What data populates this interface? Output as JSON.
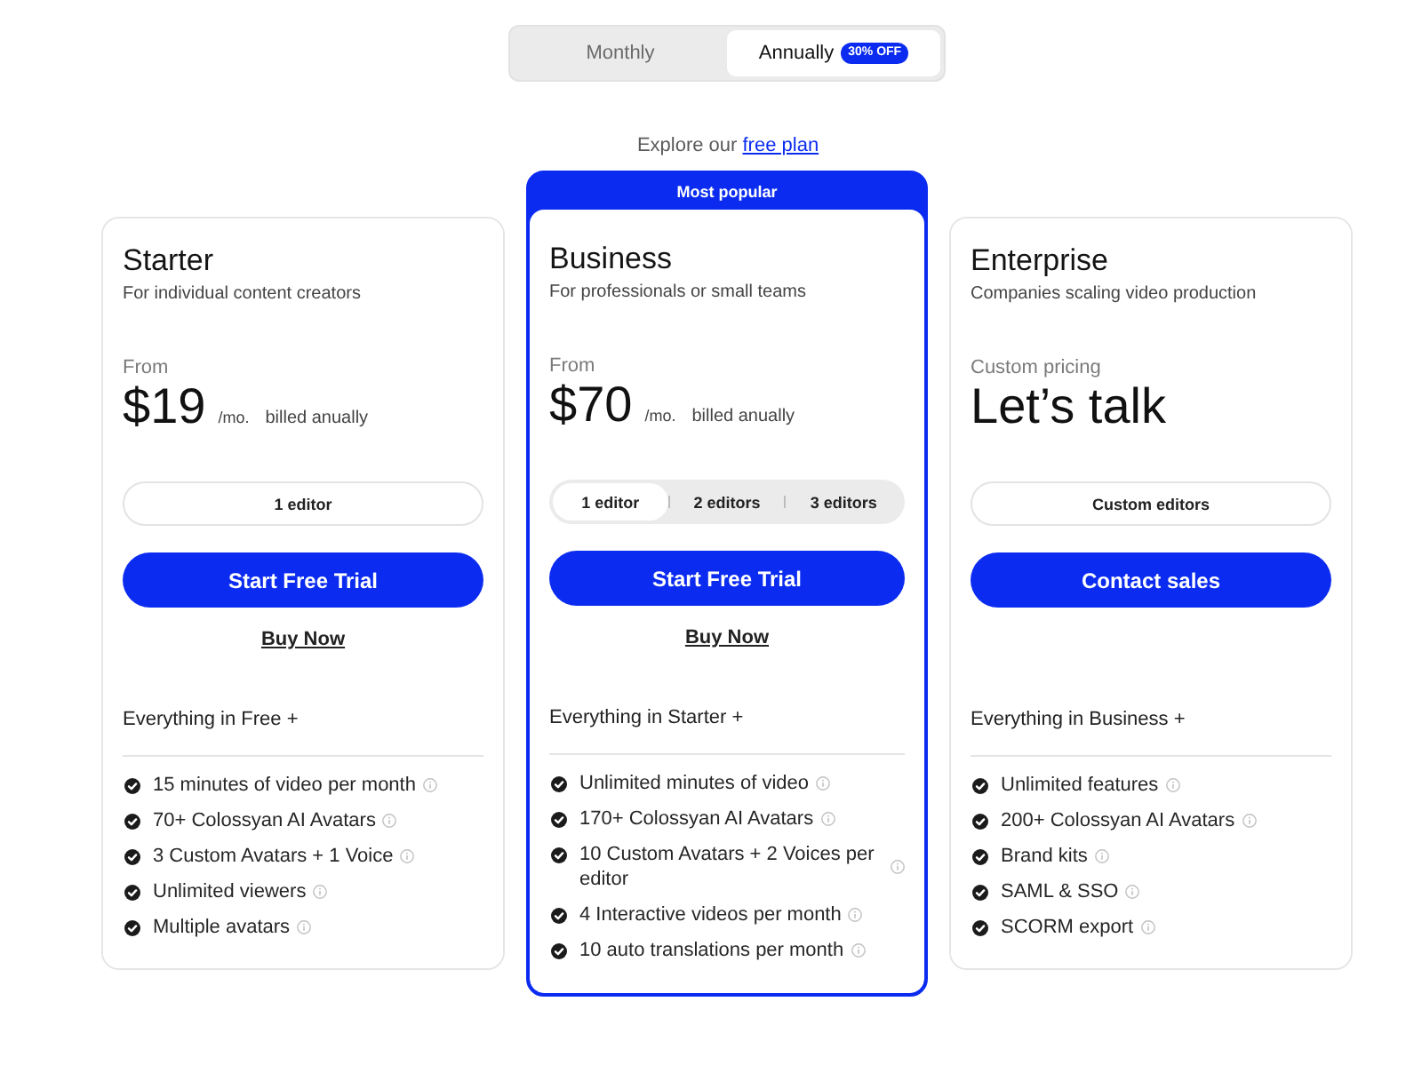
{
  "billing_toggle": {
    "options": [
      {
        "label": "Monthly",
        "selected": false
      },
      {
        "label": "Annually",
        "badge": "30% OFF",
        "selected": true
      }
    ]
  },
  "free_plan_note": {
    "text": "Explore our",
    "link": "free plan"
  },
  "plans": [
    {
      "name": "Starter",
      "featured": false,
      "tagline": "For individual content creators",
      "price_label": "From",
      "price": "$19",
      "period": "/mo.",
      "billing": "billed anually",
      "editors": {
        "kind": "fixed",
        "label": "1 editor"
      },
      "primary_button": "Start Free Trial",
      "secondary_link": "Buy Now",
      "features_heading": "Everything in Free +",
      "features": [
        "15 minutes of video per month",
        "70+ Colossyan AI Avatars",
        "3 Custom Avatars + 1 Voice",
        "Unlimited viewers",
        "Multiple avatars"
      ]
    },
    {
      "name": "Business",
      "featured": true,
      "banner": "Most popular",
      "tagline": "For professionals or small teams",
      "price_label": "From",
      "price": "$70",
      "period": "/mo.",
      "billing": "billed anually",
      "editors": {
        "kind": "choice",
        "options": [
          {
            "label": "1 editor",
            "selected": true
          },
          {
            "label": "2 editors",
            "selected": false
          },
          {
            "label": "3 editors",
            "selected": false
          }
        ]
      },
      "primary_button": "Start Free Trial",
      "secondary_link": "Buy Now",
      "features_heading": "Everything in Starter +",
      "features": [
        "Unlimited minutes of video",
        "170+ Colossyan AI Avatars",
        "10 Custom Avatars + 2 Voices per editor",
        "4 Interactive videos per month",
        "10 auto translations per month"
      ]
    },
    {
      "name": "Enterprise",
      "featured": false,
      "tagline": "Companies scaling video production",
      "price_label": "Custom pricing",
      "price": "Let’s talk",
      "editors": {
        "kind": "fixed",
        "label": "Custom editors"
      },
      "primary_button": "Contact sales",
      "features_heading": "Everything in Business +",
      "features": [
        "Unlimited features",
        "200+ Colossyan AI Avatars",
        "Brand kits",
        "SAML & SSO",
        "SCORM export"
      ]
    }
  ]
}
